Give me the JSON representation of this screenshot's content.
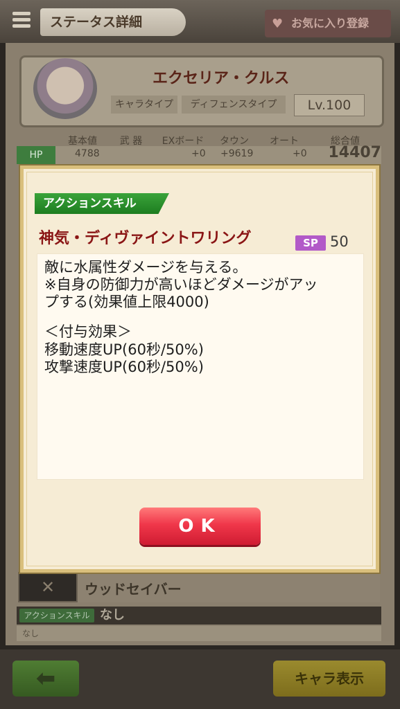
{
  "topbar": {
    "title": "ステータス詳細",
    "favorite_label": "お気に入り登録"
  },
  "character": {
    "name": "エクセリア・クルス",
    "type_label": "キャラタイプ",
    "type_value": "ディフェンスタイプ",
    "level": "Lv.100"
  },
  "stats": {
    "headers": [
      "基本値",
      "武 器",
      "EXボード",
      "タウン",
      "オート",
      "総合値"
    ],
    "hp": {
      "label": "HP",
      "base": "4788",
      "ex": "+0",
      "town": "+9619",
      "auto": "+0",
      "total": "14407"
    }
  },
  "weapon": {
    "name": "ウッドセイバー",
    "skill_tag": "アクションスキル",
    "skill_value": "なし",
    "skill_desc": "なし"
  },
  "bottom": {
    "chara_button": "キャラ表示"
  },
  "modal": {
    "tag": "アクションスキル",
    "skill_name": "神気・ディヴァイントワリング",
    "sp_label": "SP",
    "sp_value": "50",
    "description": [
      "敵に水属性ダメージを与える。",
      "※自身の防御力が高いほどダメージがアッ",
      "プする(効果値上限4000)",
      "",
      "＜付与効果＞",
      "移動速度UP(60秒/50%)",
      "攻撃速度UP(60秒/50%)"
    ],
    "ok_label": "OK"
  },
  "colors": {
    "skill_name": "#8a1515",
    "tag_green": "#2a8f2c",
    "sp_purple": "#b25ac8",
    "ok_red": "#e8283e"
  },
  "icons": [
    "menu-icon",
    "heart-icon",
    "back-arrow-icon"
  ]
}
